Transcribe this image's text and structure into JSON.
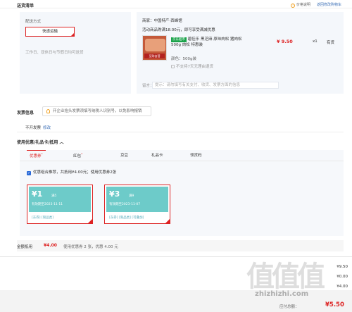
{
  "header": {
    "title": "送货清单",
    "price_note": "价格说明",
    "back_to_cart": "返回修改购物车"
  },
  "shipping": {
    "label": "配送方式",
    "method": "快递运输",
    "note": "工作日、双休日与节假日均可送货"
  },
  "goods": {
    "shop": "商家：中国特产·西峰馆",
    "promo": "活动商品购满18.00元，即可享受满减优惠",
    "image_tag": "至购自营",
    "name_badge": "京东超市",
    "name": "碧佳乐 黑芝麻 原味肉松 猪肉松500g 肉松 特惠装",
    "spec": "颜色：500g装",
    "no_return": "不支持7天无理由退货",
    "price": "¥ 9.50",
    "qty": "x1",
    "stock": "有货",
    "memo_label": "留言：",
    "memo_placeholder": "提示：请勿填写有关支付、收货、发票方面的信息"
  },
  "invoice": {
    "title": "发票信息",
    "tip": "开企业抬头发票须填写纳税人识别号，以免影响报销",
    "type": "不开发票",
    "modify": "修改"
  },
  "coupons": {
    "title": "使用优惠/礼品卡/抵用",
    "tabs": [
      {
        "label": "优惠券",
        "mark": "•"
      },
      {
        "label": "红包",
        "mark": "•"
      },
      {
        "label": "京豆",
        "mark": ""
      },
      {
        "label": "礼品卡",
        "mark": ""
      },
      {
        "label": "领货码",
        "mark": ""
      }
    ],
    "auto_option": "优惠组合推荐，共抵用¥4.00元；使用优惠券2张",
    "items": [
      {
        "amount": "¥1",
        "cond": "满5",
        "valid": "有效期至2023-11-11",
        "tags": "[东券] [限品类]"
      },
      {
        "amount": "¥3",
        "cond": "满9",
        "valid": "有效期至2023-11-07",
        "tags": "[东券] [限品类] [可叠加]"
      }
    ]
  },
  "summary": {
    "label": "金额抵用",
    "amount": "¥4.00",
    "detail": "使用优惠券 2 张，优惠 4.00 元"
  },
  "right_column": {
    "line1": "¥9.50",
    "line2": "¥0.00",
    "line3": "¥4.00"
  },
  "footer": {
    "pay_label": "应付总额：",
    "pay_amount": "¥5.50"
  },
  "watermark": {
    "chars": "值值值",
    "url": "zhizhizhi.com"
  }
}
